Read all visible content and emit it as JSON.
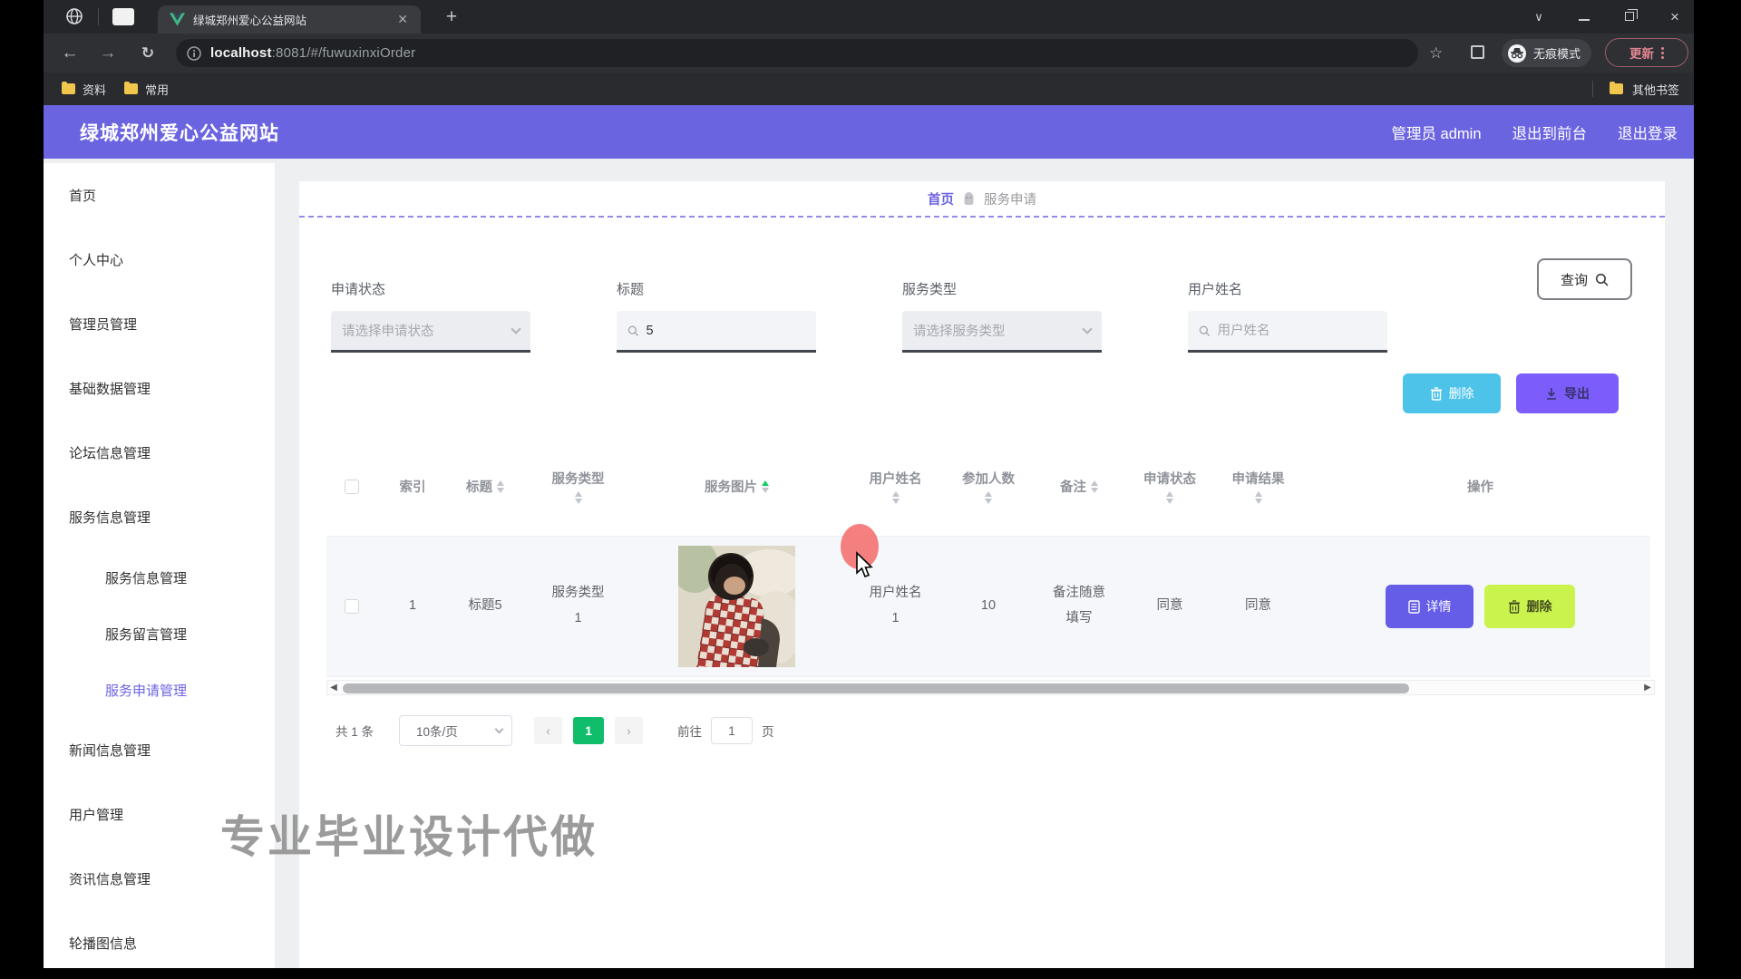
{
  "browser": {
    "tab_title": "绿城郑州爱心公益网站",
    "url_host": "localhost",
    "url_rest": ":8081/#/fuwuxinxiOrder",
    "incognito_label": "无痕模式",
    "update_label": "更新",
    "bookmarks": [
      {
        "label": "资料"
      },
      {
        "label": "常用"
      }
    ],
    "other_bookmarks": "其他书签"
  },
  "site": {
    "title": "绿城郑州爱心公益网站",
    "admin_label": "管理员 admin",
    "exit_front_label": "退出到前台",
    "logout_label": "退出登录"
  },
  "sidebar": {
    "items": [
      {
        "label": "首页"
      },
      {
        "label": "个人中心"
      },
      {
        "label": "管理员管理"
      },
      {
        "label": "基础数据管理"
      },
      {
        "label": "论坛信息管理"
      },
      {
        "label": "服务信息管理"
      },
      {
        "label": "服务信息管理"
      },
      {
        "label": "服务留言管理"
      },
      {
        "label": "服务申请管理"
      },
      {
        "label": "新闻信息管理"
      },
      {
        "label": "用户管理"
      },
      {
        "label": "资讯信息管理"
      },
      {
        "label": "轮播图信息"
      }
    ]
  },
  "breadcrumb": {
    "home": "首页",
    "current": "服务申请"
  },
  "filters": {
    "status": {
      "label": "申请状态",
      "placeholder": "请选择申请状态"
    },
    "title": {
      "label": "标题",
      "value": "5"
    },
    "type": {
      "label": "服务类型",
      "placeholder": "请选择服务类型"
    },
    "username": {
      "label": "用户姓名",
      "placeholder": "用户姓名"
    }
  },
  "toolbar": {
    "search_label": "查询",
    "delete_label": "删除",
    "export_label": "导出"
  },
  "table": {
    "columns": [
      {
        "label": ""
      },
      {
        "label": "索引"
      },
      {
        "label": "标题"
      },
      {
        "label": "服务类型"
      },
      {
        "label": "服务图片"
      },
      {
        "label": "用户姓名"
      },
      {
        "label": "参加人数"
      },
      {
        "label": "备注"
      },
      {
        "label": "申请状态"
      },
      {
        "label": "申请结果"
      },
      {
        "label": "操作"
      }
    ],
    "row": {
      "index": "1",
      "title": "标题5",
      "type": "服务类型1",
      "user": "用户姓名1",
      "count": "10",
      "remark": "备注随意填写",
      "status": "同意",
      "result": "同意"
    }
  },
  "row_actions": {
    "detail_label": "详情",
    "delete_label": "删除"
  },
  "pagination": {
    "total": "共 1 条",
    "page_size": "10条/页",
    "page": "1",
    "goto_label": "前往",
    "goto_value": "1",
    "unit_label": "页"
  },
  "watermark": {
    "text": "专业毕业设计代做"
  },
  "colors": {
    "accent_purple": "#6b64e0",
    "delete_cyan": "#4ec3ea",
    "export_purple": "#7c5cfa",
    "detail_purple": "#655ce8",
    "row_delete_lime": "#cbf34e",
    "page_green": "#0fbd6b",
    "sort_active_green": "#13ce66",
    "cursor_red": "#f46060"
  }
}
